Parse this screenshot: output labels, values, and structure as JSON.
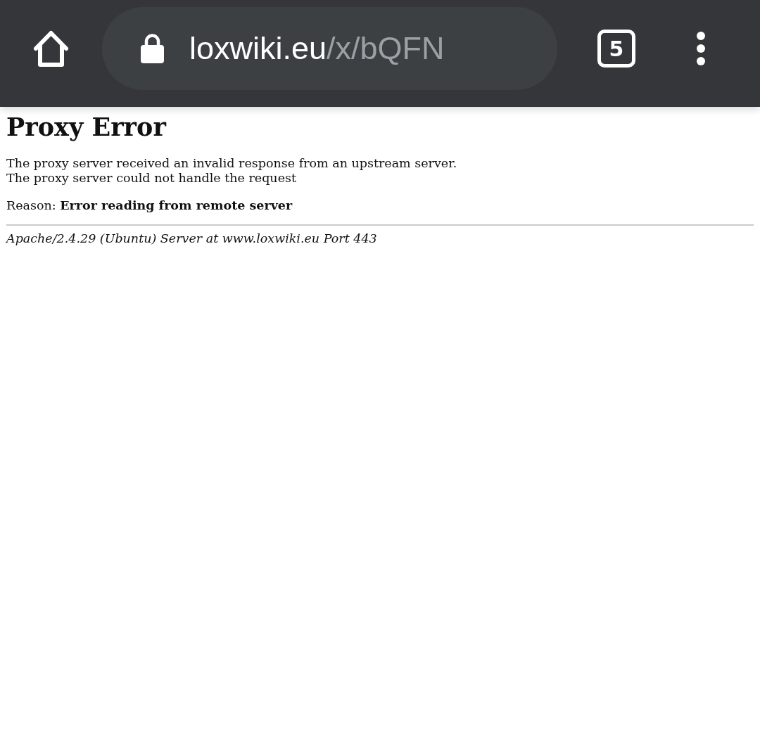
{
  "toolbar": {
    "url": {
      "host": "loxwiki.eu",
      "path": "/x/bQFN"
    },
    "tab_count": "5"
  },
  "page": {
    "title": "Proxy Error",
    "message_lines": [
      "The proxy server received an invalid response from an upstream server.",
      "The proxy server could not handle the request"
    ],
    "reason": "Reason: **Error reading from remote server**",
    "address": "Apache/2.4.29 (Ubuntu) Server at www.loxwiki.eu Port 443"
  }
}
